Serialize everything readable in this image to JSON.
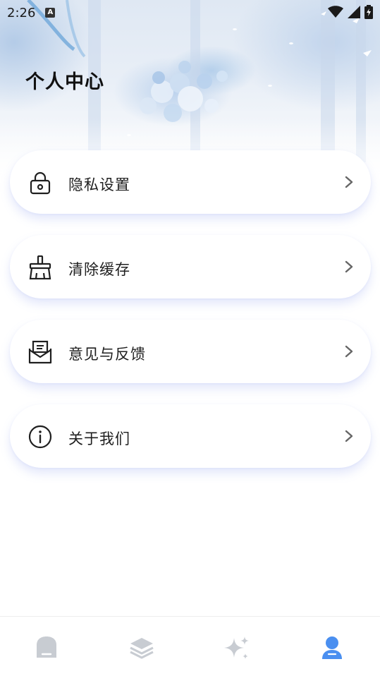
{
  "status_bar": {
    "time": "2:26",
    "notification_icon": "keyboard-a-icon",
    "wifi_icon": "wifi-icon",
    "signal_icon": "cell-signal-icon",
    "battery_icon": "battery-charging-icon"
  },
  "header": {
    "title": "个人中心"
  },
  "menu": {
    "items": [
      {
        "label": "隐私设置",
        "icon": "lock-icon"
      },
      {
        "label": "清除缓存",
        "icon": "broom-icon"
      },
      {
        "label": "意见与反馈",
        "icon": "mail-feedback-icon"
      },
      {
        "label": "关于我们",
        "icon": "info-icon"
      }
    ]
  },
  "bottom_nav": {
    "items": [
      {
        "icon": "home-icon",
        "active": false
      },
      {
        "icon": "layers-icon",
        "active": false
      },
      {
        "icon": "sparkle-icon",
        "active": false
      },
      {
        "icon": "user-icon",
        "active": true
      }
    ],
    "active_color": "#4a8ff0",
    "inactive_color": "#c8ccd2"
  },
  "colors": {
    "card_shadow": "#8296eb",
    "text": "#1f1f1f"
  }
}
